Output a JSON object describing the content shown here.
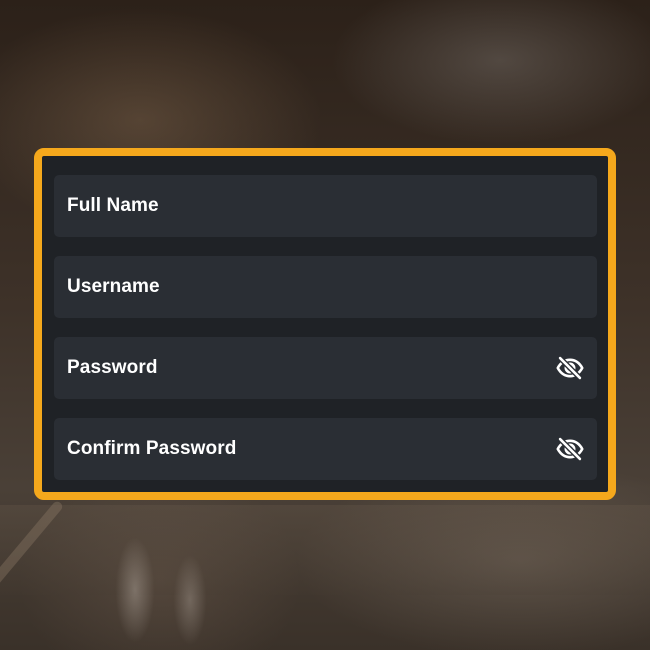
{
  "form": {
    "fields": [
      {
        "label": "Full Name",
        "has_visibility_toggle": false
      },
      {
        "label": "Username",
        "has_visibility_toggle": false
      },
      {
        "label": "Password",
        "has_visibility_toggle": true,
        "toggle_icon": "eye-off-icon"
      },
      {
        "label": "Confirm Password",
        "has_visibility_toggle": true,
        "toggle_icon": "eye-off-icon"
      }
    ]
  },
  "colors": {
    "accent_border": "#f5a81c",
    "panel_background": "#1f2226",
    "field_background": "#2a2e34",
    "label_text": "#ffffff"
  }
}
